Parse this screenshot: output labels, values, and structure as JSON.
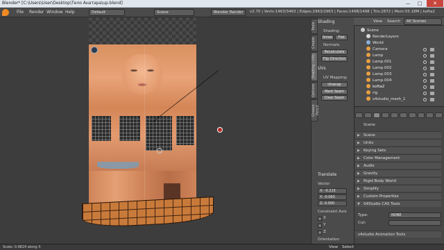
{
  "window": {
    "title": "Blender* [C:\\Users\\User\\Desktop\\Тело Анатара\\up.blend]",
    "minimize": "—",
    "maximize": "□",
    "close": "✕"
  },
  "menu": [
    "File",
    "Render",
    "Window",
    "Help"
  ],
  "layout_field": "Default",
  "scene_field": "Scene",
  "engine_field": "Blender Render",
  "stats": "v2.70 | Verts:1463/3463 | Edges:2963/2963 | Faces:1498/1498 | Tris:2872 | Mem:55.18M | kofta2",
  "toolshelf": {
    "tabs": [
      "Tools",
      "Create",
      "Shading / UVs",
      "Options",
      "Grease Pencil"
    ],
    "shading_header": "Shading",
    "shading_label": "Shading:",
    "smooth_btn": "Smoo",
    "flat_btn": "Flat",
    "normals_label": "Normals:",
    "recalculate_btn": "Recalculate",
    "flip_btn": "Flip Direction",
    "uvs_header": "UVs",
    "uv_mapping_label": "UV Mapping:",
    "unwrap_btn": "Unwrap",
    "mark_seam_btn": "Mark Seam",
    "clear_seam_btn": "Clear Seam",
    "translate_header": "Translate",
    "vector_label": "Vector",
    "vx": "X:   -0.215",
    "vy": "Y:   -0.060",
    "vz": "Z:    0.000",
    "constraint_label": "Constraint Axis",
    "cx": "X",
    "cy": "Y",
    "cz": "Z",
    "orientation_label": "Orientation"
  },
  "outliner": {
    "view": "View",
    "search": "Search",
    "filter": "All Scenes",
    "items": [
      {
        "label": "Scene",
        "color": "#c9c9c9"
      },
      {
        "label": "RenderLayers",
        "color": "#d8d8d8"
      },
      {
        "label": "World",
        "color": "#8ab0d8"
      },
      {
        "label": "Camera",
        "color": "#e8a040"
      },
      {
        "label": "Lamp",
        "color": "#e8a040"
      },
      {
        "label": "Lamp.001",
        "color": "#e8a040"
      },
      {
        "label": "Lamp.002",
        "color": "#e8a040"
      },
      {
        "label": "Lamp.003",
        "color": "#e8a040"
      },
      {
        "label": "Lamp.004",
        "color": "#e8a040"
      },
      {
        "label": "kofta2",
        "color": "#e8a040"
      },
      {
        "label": "rig",
        "color": "#e8a040"
      },
      {
        "label": "s4studio_mesh_1",
        "color": "#e8a040"
      }
    ]
  },
  "properties": {
    "scene_label": "Scene",
    "sections": [
      "Scene",
      "Units",
      "Keying Sets",
      "Color Management",
      "Audio",
      "Gravity",
      "Rigid Body World",
      "Simplify",
      "Custom Properties",
      "S4Studio CAS Tools"
    ],
    "type_label": "Type:",
    "type_value": "NONE",
    "cut_label": "Cut:",
    "anim_tools": "s4studio Animation Tools"
  },
  "statusbar": {
    "left": "Scale: 0.9824 along X",
    "view": "View",
    "select": "Select"
  }
}
